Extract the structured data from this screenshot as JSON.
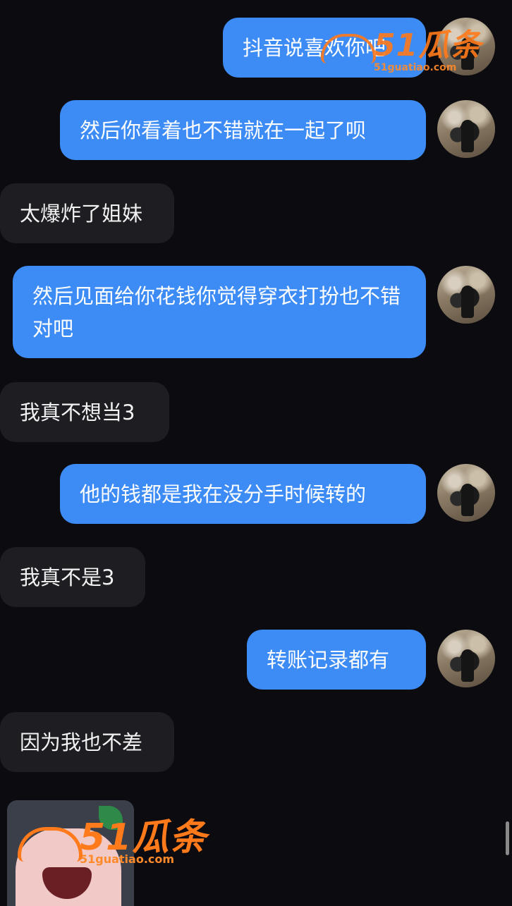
{
  "messages": [
    {
      "side": "out",
      "text": "抖音说喜欢你吧"
    },
    {
      "side": "out",
      "text": "然后你看着也不错就在一起了呗"
    },
    {
      "side": "in",
      "text": "太爆炸了姐妹"
    },
    {
      "side": "out",
      "text": "然后见面给你花钱你觉得穿衣打扮也不错对吧"
    },
    {
      "side": "in",
      "text": "我真不想当3"
    },
    {
      "side": "out",
      "text": "他的钱都是我在没分手时候转的"
    },
    {
      "side": "in",
      "text": "我真不是3"
    },
    {
      "side": "out",
      "text": "转账记录都有"
    },
    {
      "side": "in",
      "text": "因为我也不差"
    }
  ],
  "watermark": {
    "brand": "51瓜条",
    "url": "51guatiao.com"
  },
  "icons": {
    "avatar": "avatar",
    "sticker": "sticker-image"
  }
}
